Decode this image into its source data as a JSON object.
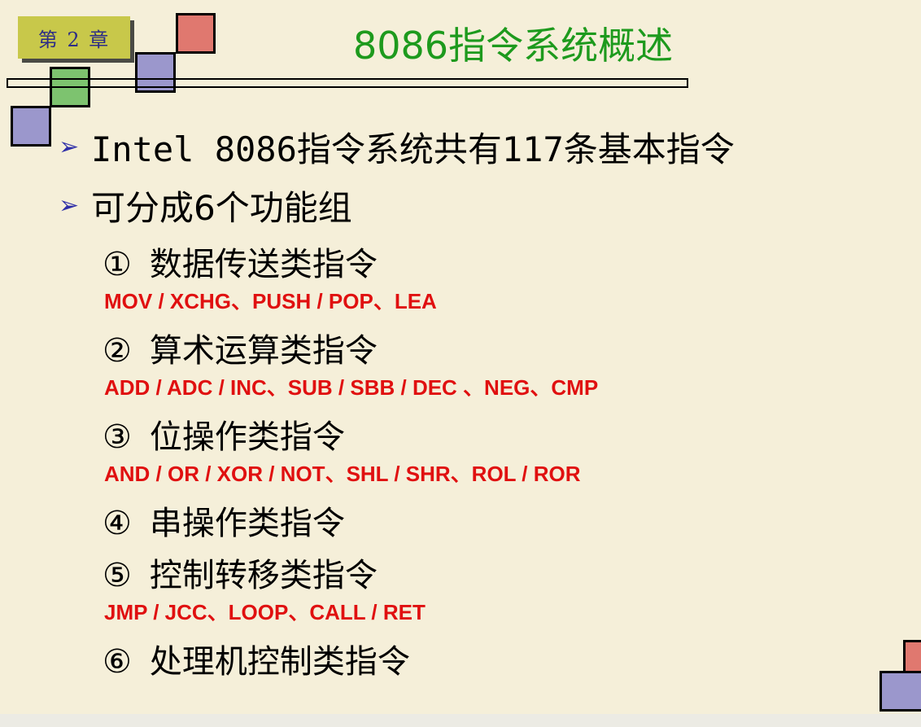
{
  "chapter_badge": "第 2 章",
  "title": "8086指令系统概述",
  "bullets": [
    {
      "prefix": "Intel 8086指令系统共有",
      "highlight": "117条",
      "suffix": "基本指令"
    },
    {
      "prefix": "可分成6个功能组",
      "highlight": "",
      "suffix": ""
    }
  ],
  "groups": [
    {
      "num": "①",
      "name": "数据传送类指令",
      "examples": "MOV / XCHG、PUSH / POP、LEA"
    },
    {
      "num": "②",
      "name": "算术运算类指令",
      "examples": "ADD / ADC / INC、SUB / SBB / DEC 、NEG、CMP"
    },
    {
      "num": "③",
      "name": "位操作类指令",
      "examples": "AND / OR / XOR / NOT、SHL / SHR、ROL / ROR"
    },
    {
      "num": "④",
      "name": "串操作类指令",
      "examples": ""
    },
    {
      "num": "⑤",
      "name": "控制转移类指令",
      "examples": "JMP / JCC、LOOP、CALL / RET"
    },
    {
      "num": "⑥",
      "name": "处理机控制类指令",
      "examples": ""
    }
  ],
  "colors": {
    "background": "#f5efd9",
    "title": "#1d9a1d",
    "highlight": "#e01010",
    "bullet_arrow": "#2e2ea8"
  },
  "icons": {
    "bullet": "arrow-right-icon"
  }
}
